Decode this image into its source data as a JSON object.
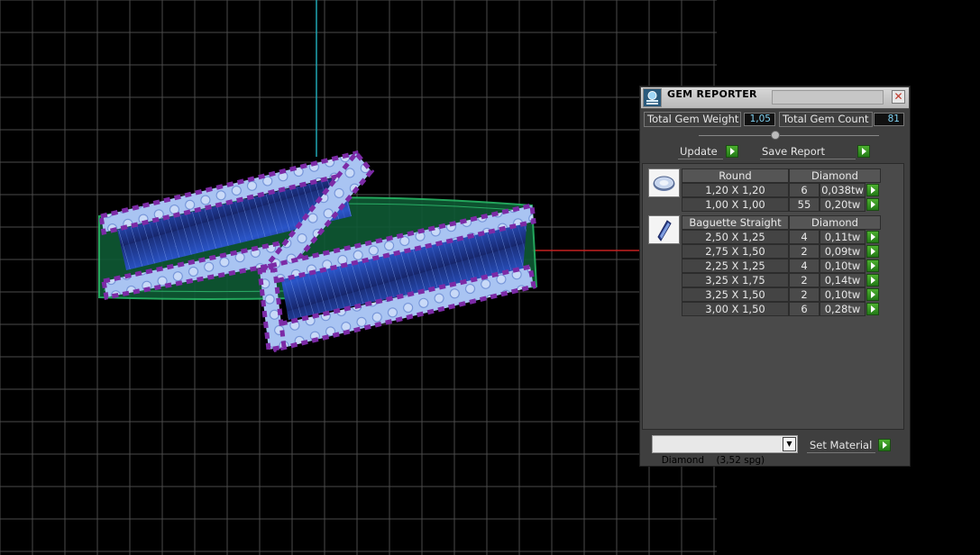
{
  "panel": {
    "title": "GEM REPORTER",
    "close_icon": "close-icon",
    "total_weight_label": "Total Gem Weight",
    "total_weight_value": "1,05",
    "total_count_label": "Total Gem Count",
    "total_count_value": "81",
    "update_label": "Update",
    "save_label": "Save Report",
    "groups": [
      {
        "icon": "round-gem-icon",
        "cut": "Round",
        "material": "Diamond",
        "rows": [
          {
            "size": "1,20 X 1,20",
            "count": "6",
            "weight": "0,038tw"
          },
          {
            "size": "1,00 X 1,00",
            "count": "55",
            "weight": "0,20tw"
          }
        ]
      },
      {
        "icon": "baguette-gem-icon",
        "cut": "Baguette Straight",
        "material": "Diamond",
        "rows": [
          {
            "size": "2,50 X 1,25",
            "count": "4",
            "weight": "0,11tw"
          },
          {
            "size": "2,75 X 1,50",
            "count": "2",
            "weight": "0,09tw"
          },
          {
            "size": "2,25 X 1,25",
            "count": "4",
            "weight": "0,10tw"
          },
          {
            "size": "3,25 X 1,75",
            "count": "2",
            "weight": "0,14tw"
          },
          {
            "size": "3,25 X 1,50",
            "count": "2",
            "weight": "0,10tw"
          },
          {
            "size": "3,00 X 1,50",
            "count": "6",
            "weight": "0,28tw"
          }
        ]
      }
    ],
    "material_select": "Diamond    (3,52 spg)",
    "set_material_label": "Set Material"
  },
  "colors": {
    "viewport_bg": "#000000",
    "grid_line": "#4a4a4a",
    "axis_y": "#1fa6b3",
    "axis_x": "#c42121",
    "band_stone": "#8fb3ea",
    "band_accent": "#7c2aa6",
    "channel": "#1c3fae",
    "shank": "#1f8a4a",
    "go_button": "#2d9a1e"
  }
}
